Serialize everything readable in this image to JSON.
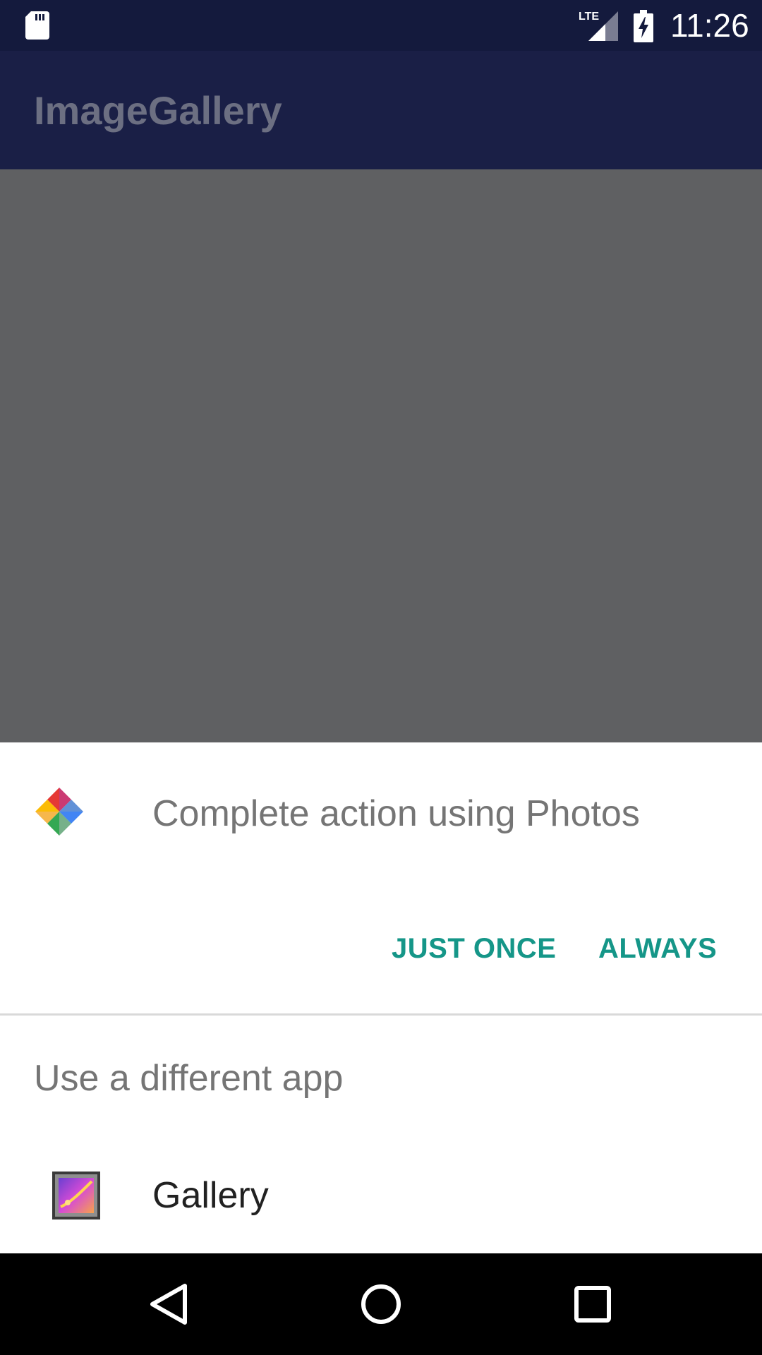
{
  "status_bar": {
    "time": "11:26",
    "icons": [
      "sd-card-icon",
      "lte-signal-icon",
      "battery-charging-icon"
    ],
    "network": "LTE"
  },
  "app_bar": {
    "title": "ImageGallery"
  },
  "chooser": {
    "title": "Complete action using Photos",
    "default_app_icon": "google-photos-icon",
    "just_once_label": "JUST ONCE",
    "always_label": "ALWAYS",
    "alternative_label": "Use a different app",
    "apps": [
      {
        "label": "Gallery",
        "icon": "gallery-icon"
      }
    ]
  },
  "nav_bar": {
    "icons": [
      "back-icon",
      "home-icon",
      "recents-icon"
    ]
  },
  "colors": {
    "status_bar": "#141a3d",
    "app_bar": "#1a1f46",
    "scrim": "#5f6062",
    "accent": "#159688",
    "secondary_text": "#757575",
    "primary_text": "#212121"
  }
}
